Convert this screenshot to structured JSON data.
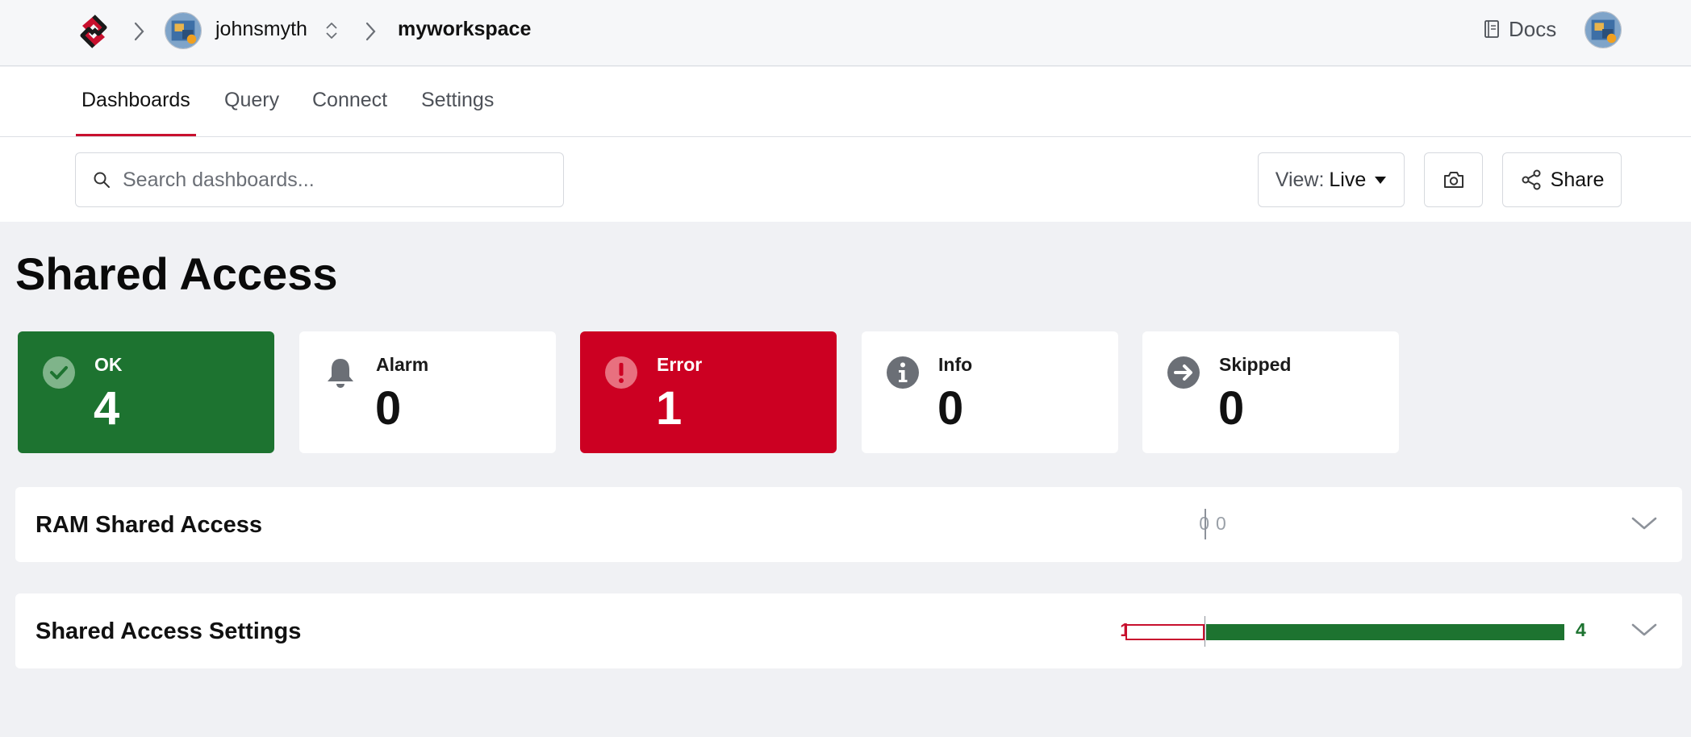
{
  "breadcrumb": {
    "user": "johnsmyth",
    "workspace": "myworkspace"
  },
  "header": {
    "docs_label": "Docs"
  },
  "tabs": [
    {
      "label": "Dashboards",
      "active": true
    },
    {
      "label": "Query",
      "active": false
    },
    {
      "label": "Connect",
      "active": false
    },
    {
      "label": "Settings",
      "active": false
    }
  ],
  "toolbar": {
    "search_placeholder": "Search dashboards...",
    "view_label": "View:",
    "view_value": "Live",
    "share_label": "Share"
  },
  "page": {
    "title": "Shared Access"
  },
  "summary": [
    {
      "key": "ok",
      "label": "OK",
      "value": "4",
      "icon": "check-circle-icon",
      "color": "#1d7330"
    },
    {
      "key": "alarm",
      "label": "Alarm",
      "value": "0",
      "icon": "bell-icon",
      "color": "#ffffff"
    },
    {
      "key": "error",
      "label": "Error",
      "value": "1",
      "icon": "exclamation-circle-icon",
      "color": "#cc0022"
    },
    {
      "key": "info",
      "label": "Info",
      "value": "0",
      "icon": "info-circle-icon",
      "color": "#ffffff"
    },
    {
      "key": "skipped",
      "label": "Skipped",
      "value": "0",
      "icon": "arrow-right-circle-icon",
      "color": "#ffffff"
    }
  ],
  "panels": [
    {
      "title": "RAM Shared Access",
      "left_count": "0",
      "right_count": "0"
    },
    {
      "title": "Shared Access Settings",
      "left_count": "1",
      "right_count": "4"
    }
  ],
  "colors": {
    "accent": "#c8102e",
    "ok": "#1d7330",
    "error": "#cc0022"
  }
}
